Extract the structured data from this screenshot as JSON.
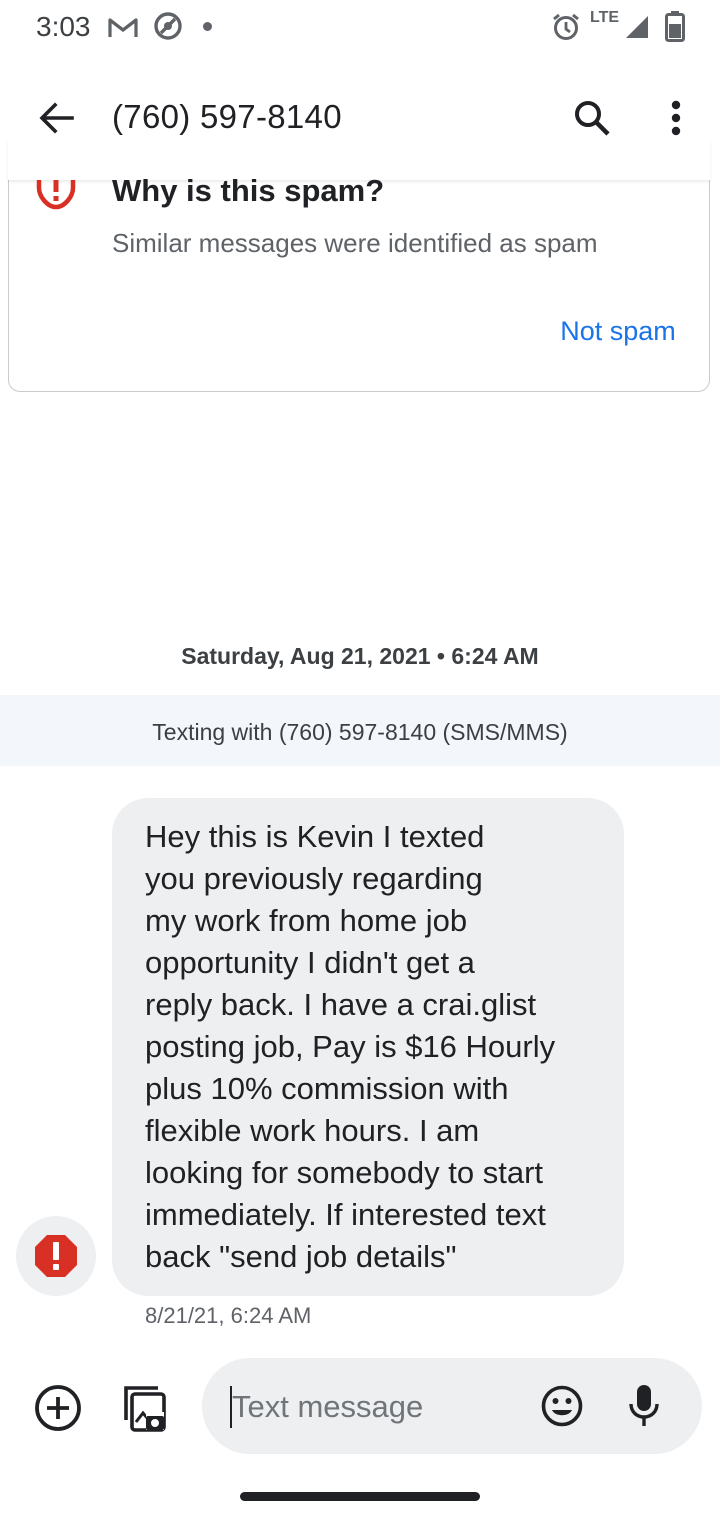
{
  "status_bar": {
    "time": "3:03",
    "network": "LTE",
    "icons": [
      "gmail-icon",
      "no-disturb-icon",
      "dot-icon",
      "alarm-icon",
      "signal-icon",
      "battery-icon"
    ]
  },
  "app_bar": {
    "title": "(760) 597-8140",
    "icons": [
      "back-arrow-icon",
      "search-icon",
      "more-vert-icon"
    ]
  },
  "spam_card": {
    "title": "Why is this spam?",
    "description": "Similar messages were identified as spam",
    "action_label": "Not spam",
    "icon": "spam-warning-icon",
    "accent_color": "#d93025",
    "action_color": "#1a73e8"
  },
  "conversation": {
    "date_header": "Saturday, Aug 21, 2021 • 6:24 AM",
    "texting_with": "Texting with (760) 597-8140 (SMS/MMS)",
    "messages": [
      {
        "lines": [
          "Hey this is Kevin I texted",
          "you previously regarding",
          "my work from home job",
          "opportunity I didn't get a",
          "reply back. I have a crai.glist",
          "posting job, Pay is $16 Hourly",
          "plus 10% commission with",
          "flexible work hours. I am",
          "looking for somebody to start",
          "immediately. If interested text",
          "back \"send job details\""
        ],
        "timestamp": "8/21/21, 6:24 AM",
        "avatar_icon": "spam-alert-icon"
      }
    ]
  },
  "compose": {
    "placeholder": "Text message",
    "icons": [
      "add-circle-icon",
      "gallery-icon",
      "emoji-icon",
      "mic-icon"
    ]
  }
}
